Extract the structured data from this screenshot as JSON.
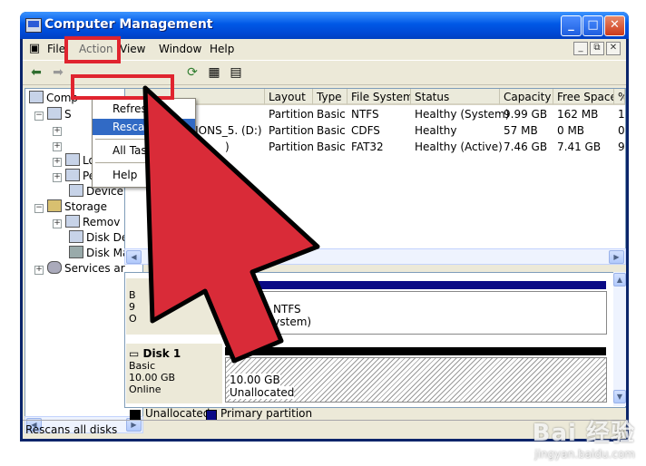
{
  "window": {
    "title": "Computer Management"
  },
  "menubar": {
    "items": [
      "File",
      "Action",
      "View",
      "Window",
      "Help"
    ]
  },
  "action_menu": {
    "items": [
      "Refresh",
      "Rescan Disks",
      "All Tasks",
      "Help"
    ],
    "selected": "Rescan Disks"
  },
  "tree": {
    "items": [
      {
        "label": "Comp",
        "icon": "computer-icon"
      },
      {
        "label": "S",
        "icon": "tools-icon"
      },
      {
        "label": "Local U",
        "icon": "users-icon"
      },
      {
        "label": "Perforn",
        "icon": "performance-icon"
      },
      {
        "label": "Device",
        "icon": "device-icon"
      },
      {
        "label": "Storage",
        "icon": "storage-icon"
      },
      {
        "label": "Remov",
        "icon": "removable-icon"
      },
      {
        "label": "Disk De",
        "icon": "defrag-icon"
      },
      {
        "label": "Disk Ma",
        "icon": "disk-icon"
      },
      {
        "label": "Services ar",
        "icon": "services-icon"
      }
    ]
  },
  "volume_list": {
    "columns": [
      "Layout",
      "Type",
      "File System",
      "Status",
      "Capacity",
      "Free Space",
      "%"
    ],
    "rows": [
      {
        "volume": "",
        "layout": "Partition",
        "type": "Basic",
        "fs": "NTFS",
        "status": "Healthy (System)",
        "capacity": "9.99 GB",
        "free": "162 MB",
        "pct": "1"
      },
      {
        "volume": "DITIONS_5. (D:)",
        "layout": "Partition",
        "type": "Basic",
        "fs": "CDFS",
        "status": "Healthy",
        "capacity": "57 MB",
        "free": "0 MB",
        "pct": "0"
      },
      {
        "volume": ")",
        "layout": "Partition",
        "type": "Basic",
        "fs": "FAT32",
        "status": "Healthy (Active)",
        "capacity": "7.46 GB",
        "free": "7.41 GB",
        "pct": "9"
      }
    ]
  },
  "graphical_view": {
    "disk0": {
      "l1": "B",
      "l2": "9",
      "l3": "O",
      "vol_fs": "B NTFS",
      "vol_status": "(System)"
    },
    "disk1": {
      "name": "Disk 1",
      "type": "Basic",
      "size": "10.00 GB",
      "state": "Online",
      "part_size": "10.00 GB",
      "part_status": "Unallocated"
    }
  },
  "legend": {
    "items": [
      {
        "label": "Unallocated",
        "color": "#000000"
      },
      {
        "label": "Primary partition",
        "color": "#0a0a85"
      }
    ]
  },
  "statusbar": {
    "text": "Rescans all disks"
  },
  "colors": {
    "highlight": "#e0242f",
    "selection": "#316ac5",
    "titlebar": "#0058e6"
  },
  "watermark": {
    "main": "Bai 经验",
    "sub": "jingyan.baidu.com"
  }
}
